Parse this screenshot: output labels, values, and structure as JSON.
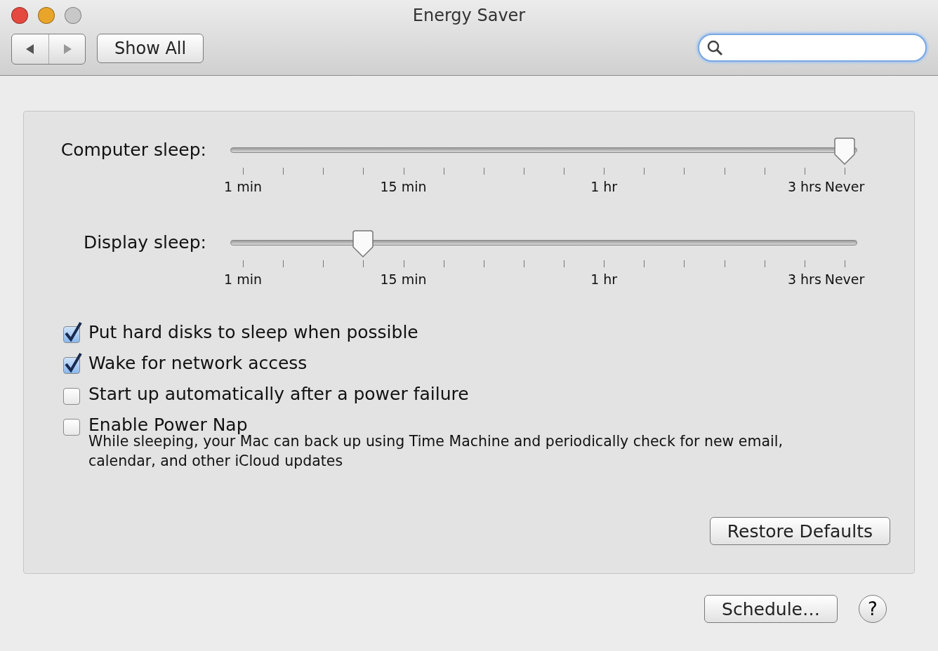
{
  "window": {
    "title": "Energy Saver"
  },
  "toolbar": {
    "show_all": "Show All"
  },
  "sliders": [
    {
      "label": "Computer sleep:",
      "level": 1.0,
      "tick_labels": [
        "1 min",
        "15 min",
        "1 hr",
        "3 hrs",
        "Never"
      ]
    },
    {
      "label": "Display sleep:",
      "level": 0.2,
      "tick_labels": [
        "1 min",
        "15 min",
        "1 hr",
        "3 hrs",
        "Never"
      ]
    }
  ],
  "options": [
    {
      "label": "Put hard disks to sleep when possible",
      "checked": true
    },
    {
      "label": "Wake for network access",
      "checked": true
    },
    {
      "label": "Start up automatically after a power failure",
      "checked": false
    },
    {
      "label": "Enable Power Nap",
      "checked": false,
      "description": "While sleeping, your Mac can back up using Time Machine and periodically check for new email, calendar, and other iCloud updates"
    }
  ],
  "restore_button": "Restore Defaults",
  "schedule_button": "Schedule…",
  "help_button": "?"
}
